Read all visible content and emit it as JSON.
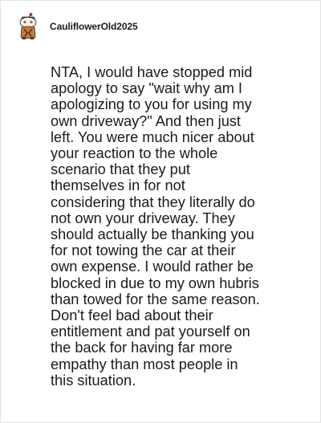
{
  "comment": {
    "username": "CauliflowerOld2025",
    "avatar_icon": "snoo-avatar-icon",
    "body": "NTA, I would have stopped mid\napology to say \"wait why am I\napologizing to you for using my\nown driveway?\" And then just\nleft. You were much nicer about\nyour reaction to the whole\nscenario that they put\nthemselves in for not\nconsidering that they literally do\nnot own your driveway. They\nshould actually be thanking you\nfor not towing the car at their\nown expense. I would rather be\nblocked in due to my own hubris\nthan towed for the same reason.\nDon't feel bad about their\nentitlement and pat yourself on\nthe back for having far more\nempathy than most people in\nthis situation."
  }
}
